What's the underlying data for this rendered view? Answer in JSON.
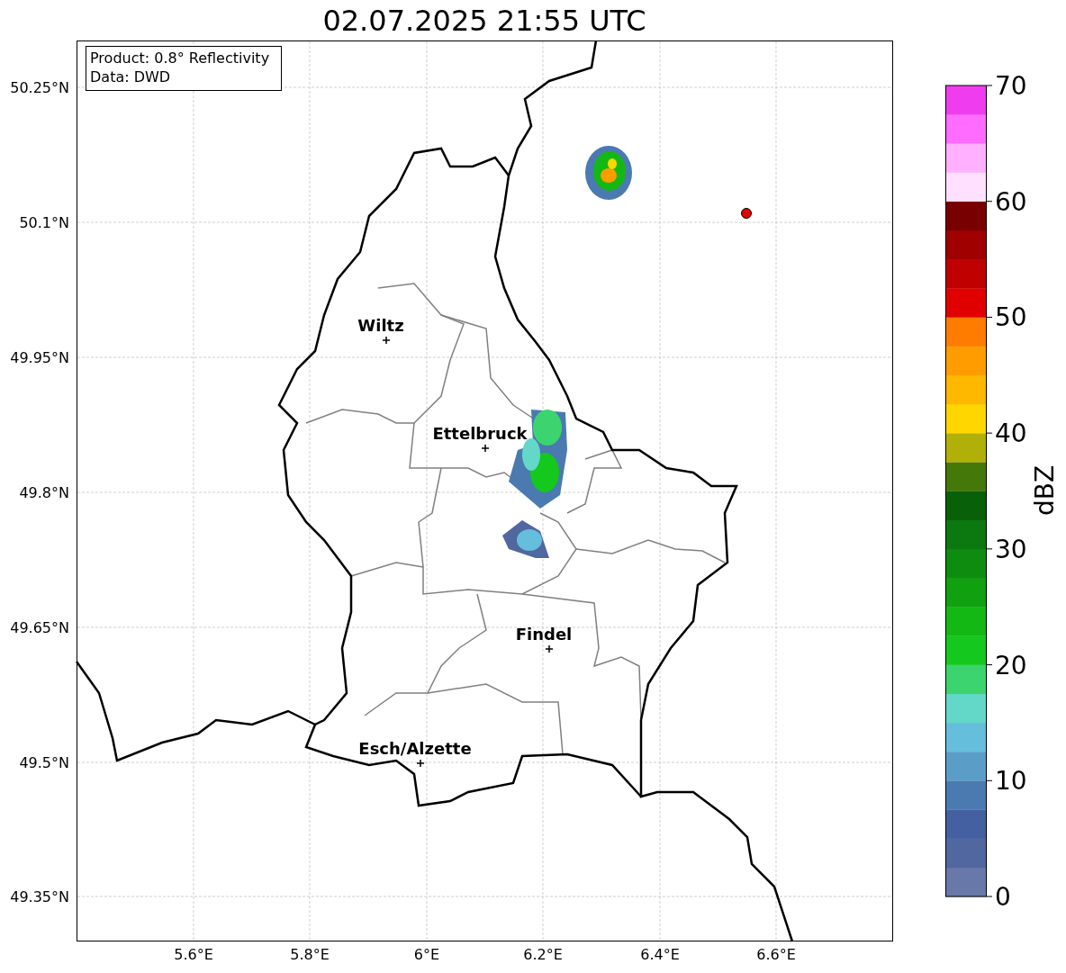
{
  "title": "02.07.2025 21:55 UTC",
  "map": {
    "legend": [
      "Product: 0.8° Reflectivity",
      "Data: DWD"
    ],
    "x_tick_labels": [
      "5.6°E",
      "5.8°E",
      "6°E",
      "6.2°E",
      "6.4°E",
      "6.6°E"
    ],
    "y_tick_labels": [
      "50.25°N",
      "50.1°N",
      "49.95°N",
      "49.8°N",
      "49.65°N",
      "49.5°N",
      "49.35°N"
    ],
    "places": [
      {
        "name": "Wiltz"
      },
      {
        "name": "Ettelbruck"
      },
      {
        "name": "Findel"
      },
      {
        "name": "Esch/Alzette"
      }
    ]
  },
  "colorbar": {
    "label": "dBZ",
    "ticks": [
      "70",
      "60",
      "50",
      "40",
      "30",
      "20",
      "10",
      "0"
    ],
    "bins": [
      {
        "color": "#6878a8"
      },
      {
        "color": "#5067a0"
      },
      {
        "color": "#4560a0"
      },
      {
        "color": "#4a7ab0"
      },
      {
        "color": "#5a9ec8"
      },
      {
        "color": "#64bedc"
      },
      {
        "color": "#64d8c8"
      },
      {
        "color": "#3cd46e"
      },
      {
        "color": "#14c81e"
      },
      {
        "color": "#14b814"
      },
      {
        "color": "#10a010"
      },
      {
        "color": "#0e8c10"
      },
      {
        "color": "#0c7810"
      },
      {
        "color": "#086008"
      },
      {
        "color": "#447808"
      },
      {
        "color": "#b0b008"
      },
      {
        "color": "#ffd600"
      },
      {
        "color": "#ffb800"
      },
      {
        "color": "#ff9c00"
      },
      {
        "color": "#ff7c00"
      },
      {
        "color": "#e00000"
      },
      {
        "color": "#c00000"
      },
      {
        "color": "#a00000"
      },
      {
        "color": "#780000"
      },
      {
        "color": "#ffe0ff"
      },
      {
        "color": "#ffb0ff"
      },
      {
        "color": "#ff6cff"
      },
      {
        "color": "#ee3cee"
      }
    ]
  }
}
